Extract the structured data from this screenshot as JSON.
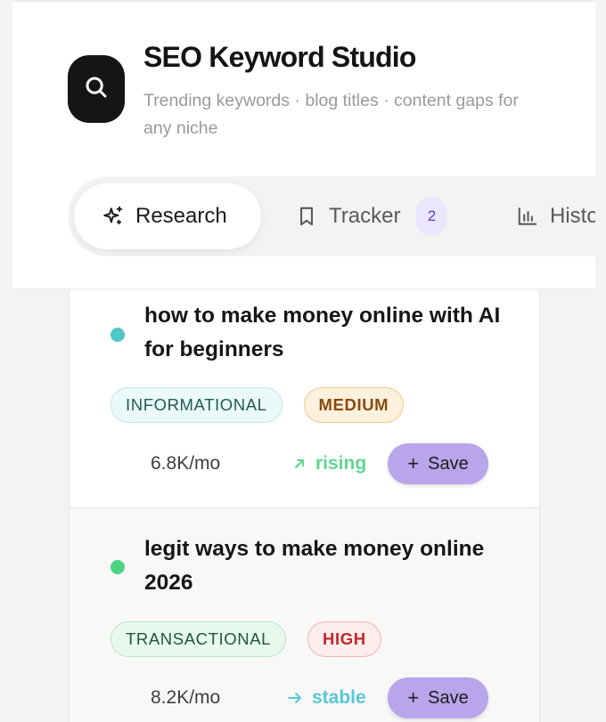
{
  "app": {
    "title": "SEO Keyword Studio",
    "subtitle": "Trending keywords · blog titles · content gaps for any niche",
    "logo_icon": "search-icon"
  },
  "tabs": [
    {
      "label": "Research",
      "icon": "sparkles-icon",
      "active": true
    },
    {
      "label": "Tracker",
      "icon": "bookmark-icon",
      "badge": "2",
      "active": false
    },
    {
      "label": "Histo",
      "icon": "bar-chart-icon",
      "active": false
    }
  ],
  "keywords": [
    {
      "keyword": "how to make money online with AI for beginners",
      "dot_color": "#4fc7c7",
      "intent": "INFORMATIONAL",
      "difficulty": "MEDIUM",
      "volume": "6.8K/mo",
      "trend": "rising",
      "trend_icon": "arrow-up-right-icon",
      "save_label": "Save"
    },
    {
      "keyword": "legit ways to make money online 2026",
      "dot_color": "#4ed483",
      "intent": "TRANSACTIONAL",
      "difficulty": "HIGH",
      "volume": "8.2K/mo",
      "trend": "stable",
      "trend_icon": "arrow-right-icon",
      "save_label": "Save"
    }
  ],
  "colors": {
    "accent": "#b8a5ea",
    "rising": "#5fd690",
    "stable": "#58c8d6",
    "logo_bg": "#151515"
  }
}
